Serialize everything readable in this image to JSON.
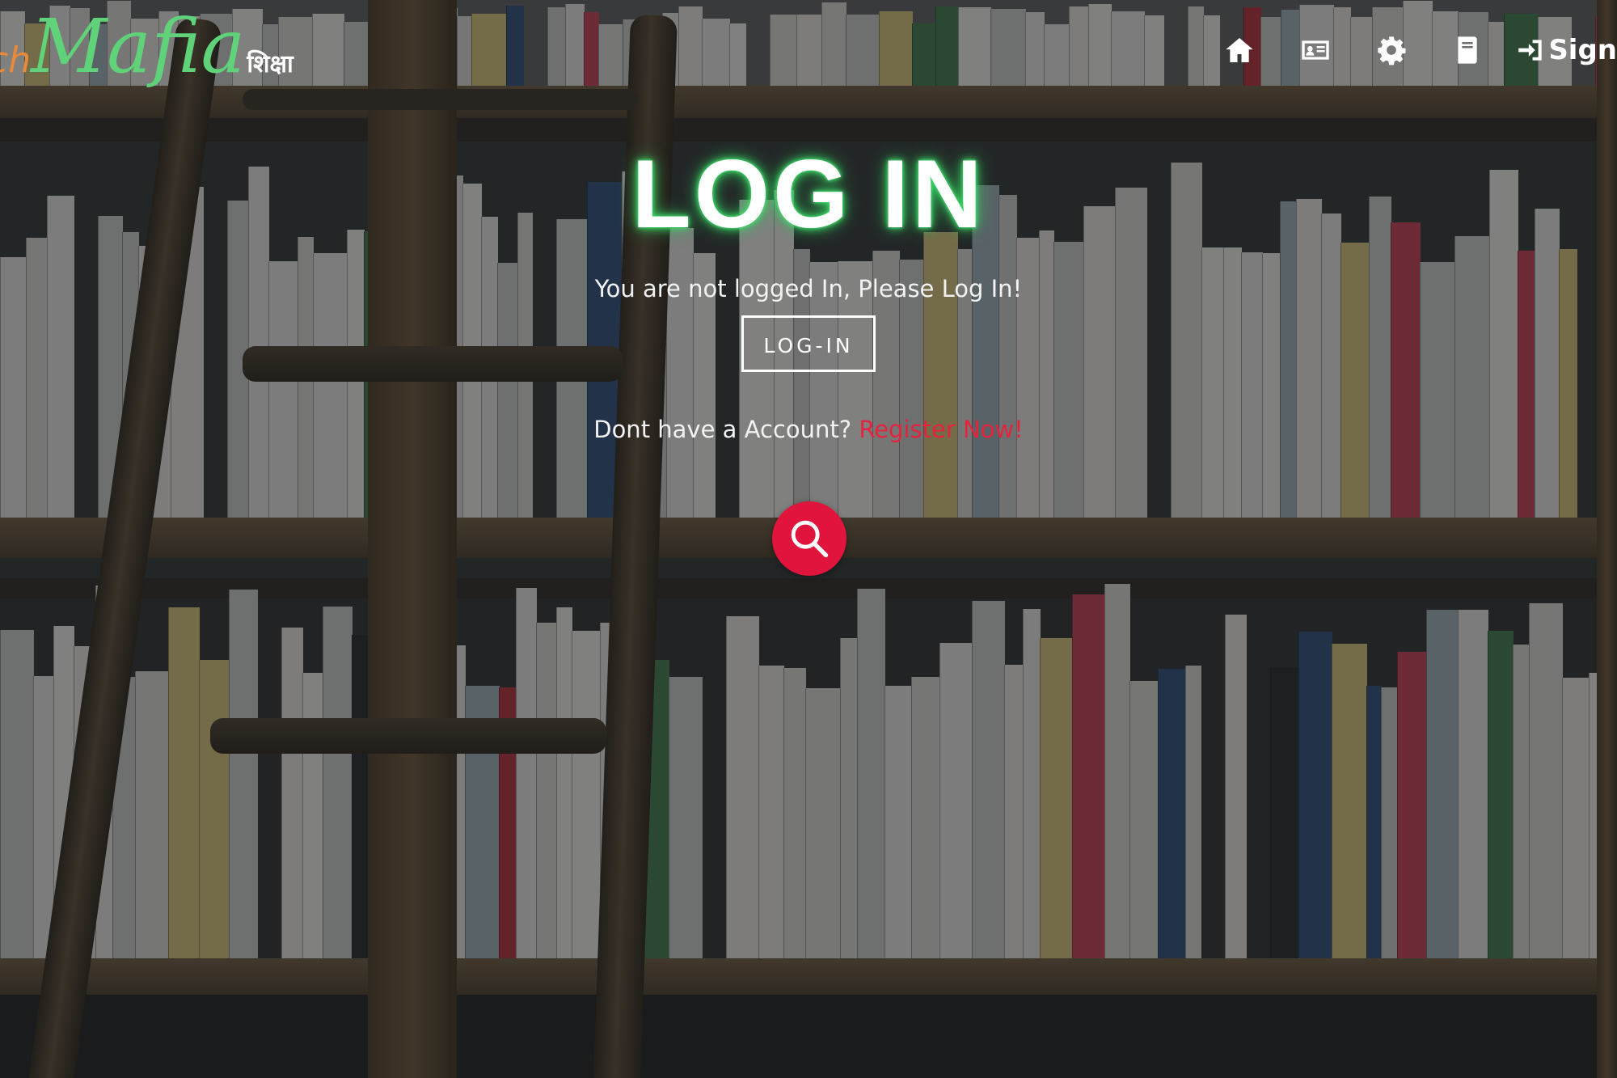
{
  "brand": {
    "prefix": "ch",
    "name": "Mafia",
    "suffix": "शिक्षा"
  },
  "nav": {
    "icons": [
      "home-icon",
      "id-card-icon",
      "gear-icon",
      "book-icon"
    ],
    "signin_label": "Sign"
  },
  "login": {
    "title": "LOG IN",
    "notice": "You are not logged In, Please Log In!",
    "button_label": "LOG-IN",
    "register_prompt": "Dont have a Account?",
    "register_link": "Register Now!"
  },
  "colors": {
    "brand_green": "#5fd27a",
    "brand_orange": "#e98a3a",
    "accent_red": "#e0143c",
    "title_glow": "#3ee06a"
  }
}
